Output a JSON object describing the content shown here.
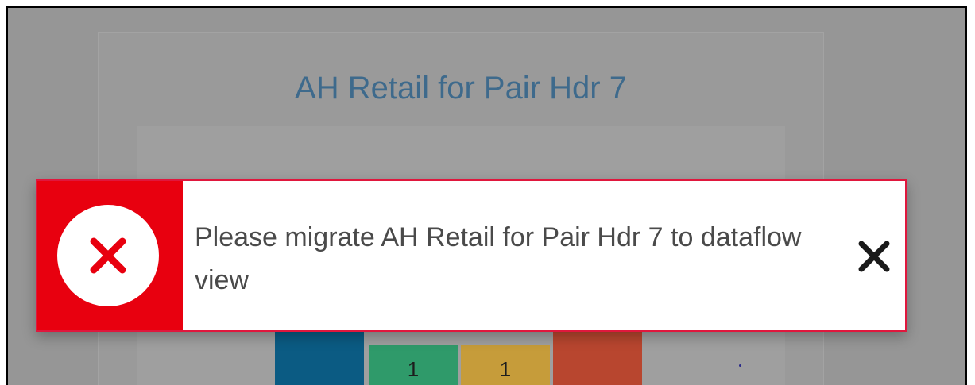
{
  "background_card": {
    "title": "AH Retail for Pair Hdr 7",
    "bars": [
      {
        "color": "#0b5b83",
        "label": ""
      },
      {
        "color": "#2f9a6a",
        "label": "1"
      },
      {
        "color": "#c69c3a",
        "label": "1"
      },
      {
        "color": "#b8462f",
        "label": ""
      }
    ]
  },
  "toast": {
    "type": "error",
    "accent_color": "#e8000f",
    "icon": "error-x-icon",
    "message": "Please migrate AH Retail for Pair Hdr 7 to dataflow view",
    "close_icon": "close-icon"
  }
}
